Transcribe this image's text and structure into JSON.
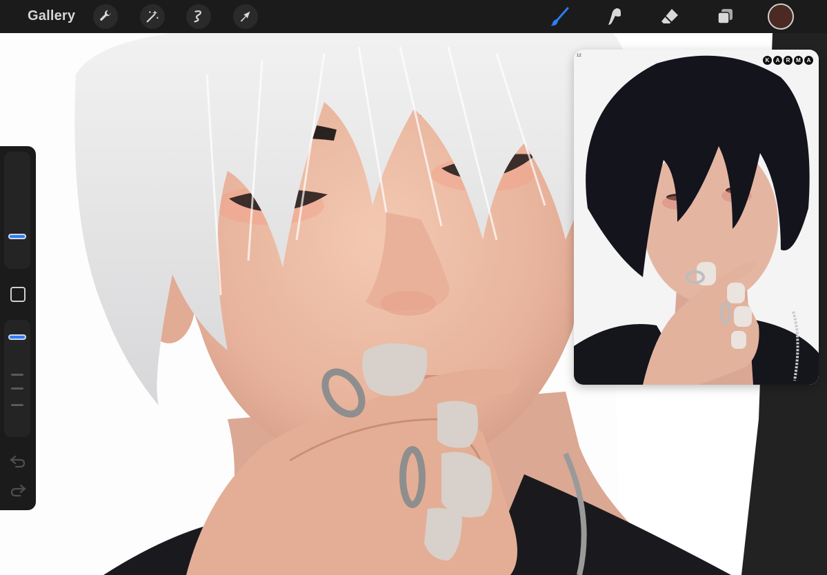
{
  "topbar": {
    "gallery_label": "Gallery",
    "tools_left": [
      {
        "name": "wrench-icon",
        "label": "Actions"
      },
      {
        "name": "magic-wand-icon",
        "label": "Adjustments"
      },
      {
        "name": "selection-icon",
        "label": "Selection"
      },
      {
        "name": "arrow-cursor-icon",
        "label": "Transform"
      }
    ],
    "tools_right": [
      {
        "name": "brush-icon",
        "label": "Paint",
        "active": true
      },
      {
        "name": "smudge-icon",
        "label": "Smudge"
      },
      {
        "name": "eraser-icon",
        "label": "Erase"
      },
      {
        "name": "layers-icon",
        "label": "Layers"
      }
    ],
    "current_color": "#4a2a22"
  },
  "sidebar": {
    "brush_size_level": 0.25,
    "opacity_level": 0.9
  },
  "reference": {
    "page_number": "12",
    "logo_letters": [
      "K",
      "A",
      "R",
      "M",
      "A"
    ]
  },
  "colors": {
    "accent": "#2e7cf6",
    "toolbar_bg": "#1b1b1b",
    "skin": "#eab79f",
    "hair": "#e6e6e6"
  }
}
